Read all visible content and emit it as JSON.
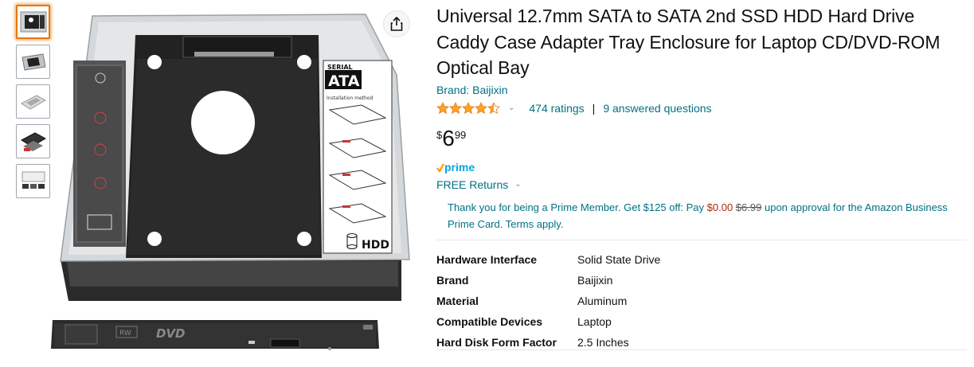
{
  "product": {
    "title": "Universal 12.7mm SATA to SATA 2nd SSD HDD Hard Drive Caddy Case Adapter Tray Enclosure for Laptop CD/DVD-ROM Optical Bay",
    "brand_link": "Brand: Baijixin",
    "rating": 4.5,
    "ratings_text": "474 ratings",
    "separator": "|",
    "questions_text": "9 answered questions",
    "price": {
      "symbol": "$",
      "whole": "6",
      "fraction": "99"
    },
    "prime_label": "prime",
    "free_returns": "FREE Returns",
    "promo": {
      "part1": "Thank you for being a Prime Member. Get $125 off: Pay ",
      "new_price": "$0.00",
      "old_price": "$6.99",
      "part2": " upon approval for the Amazon Business Prime Card. Terms apply."
    },
    "specs": [
      {
        "key": "Hardware Interface",
        "value": "Solid State Drive"
      },
      {
        "key": "Brand",
        "value": "Baijixin"
      },
      {
        "key": "Material",
        "value": "Aluminum"
      },
      {
        "key": "Compatible Devices",
        "value": "Laptop"
      },
      {
        "key": "Hard Disk Form Factor",
        "value": "2.5 Inches"
      }
    ]
  },
  "image_labels": {
    "serial": "SERIAL",
    "ata": "ATA",
    "installation": "Installation method",
    "hdd": "HDD",
    "rw": "RW",
    "dvd": "DVD"
  },
  "colors": {
    "link": "#007185",
    "price_red": "#B12704",
    "star": "#FFA41C",
    "prime_blue": "#00A8E1",
    "thumb_active": "#e77600"
  },
  "icons": {
    "share": "share-icon",
    "star": "star-icon",
    "chevron": "chevron-down-icon",
    "prime_check": "prime-check-icon"
  }
}
